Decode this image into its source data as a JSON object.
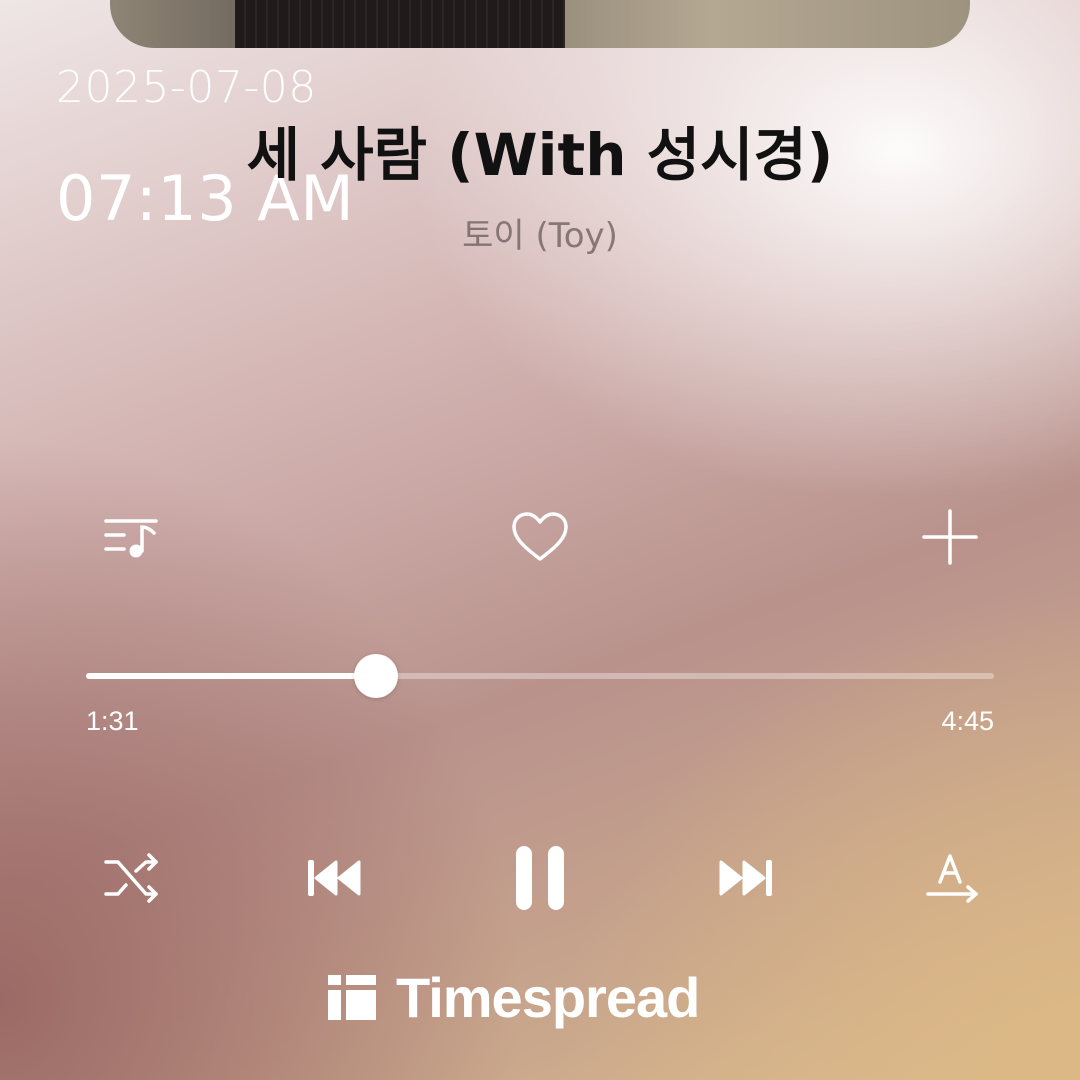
{
  "status": {
    "date": "2025-07-08",
    "time": "07:13 AM"
  },
  "track": {
    "title": "세 사람 (With 성시경)",
    "artist": "토이 (Toy)"
  },
  "actions": [
    {
      "icon": "playlist-music-icon"
    },
    {
      "icon": "heart-icon"
    },
    {
      "icon": "plus-icon"
    }
  ],
  "playback": {
    "elapsed": "1:31",
    "duration": "4:45",
    "progress_fraction": 0.319,
    "state": "playing"
  },
  "controls": [
    {
      "icon": "shuffle-icon"
    },
    {
      "icon": "previous-track-icon"
    },
    {
      "icon": "pause-icon"
    },
    {
      "icon": "next-track-icon"
    },
    {
      "icon": "translate-lyrics-icon"
    }
  ],
  "brand": {
    "name": "Timespread"
  }
}
